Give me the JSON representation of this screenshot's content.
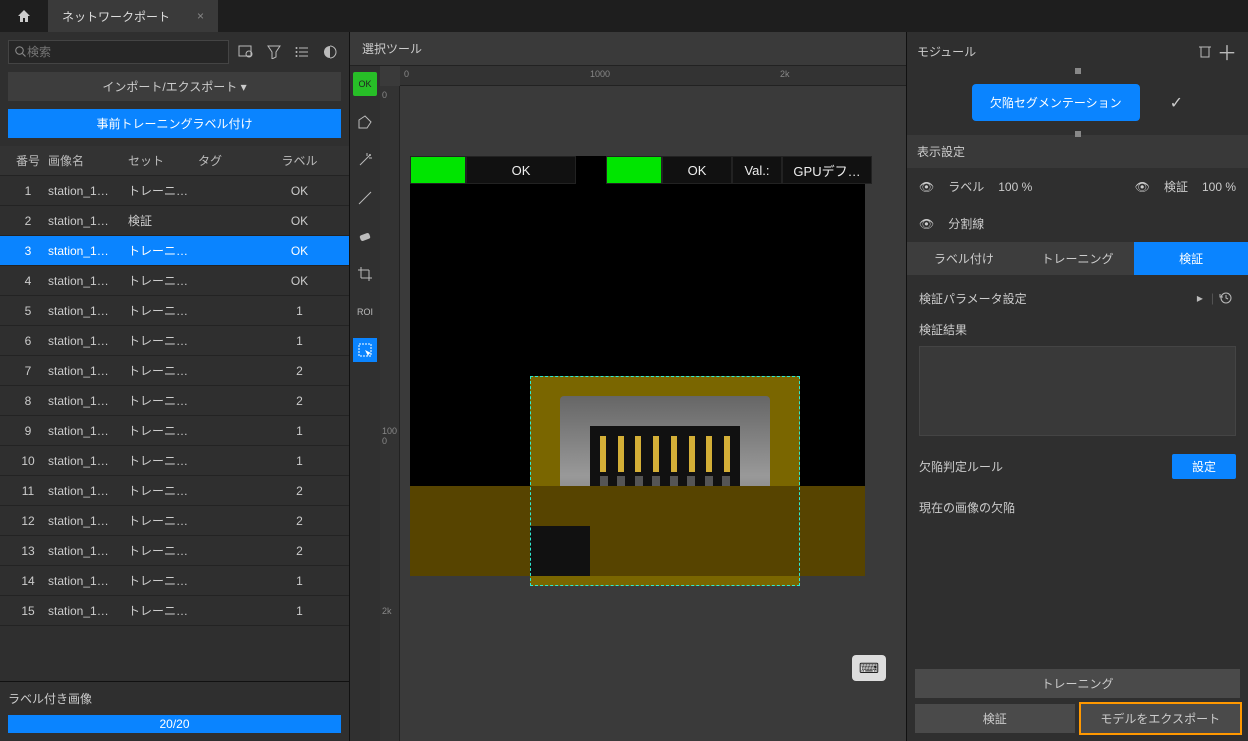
{
  "titlebar": {
    "tab_name": "ネットワークポート",
    "close": "×"
  },
  "left": {
    "search_placeholder": "検索",
    "import_export": "インポート/エクスポート ▾",
    "pretrain": "事前トレーニングラベル付け",
    "columns": {
      "idx": "番号",
      "name": "画像名",
      "set": "セット",
      "tag": "タグ",
      "label": "ラベル"
    },
    "rows": [
      {
        "idx": "1",
        "name": "station_1…",
        "set": "トレーニ…",
        "label": "OK"
      },
      {
        "idx": "2",
        "name": "station_1…",
        "set": "検証",
        "label": "OK"
      },
      {
        "idx": "3",
        "name": "station_1…",
        "set": "トレーニ…",
        "label": "OK",
        "selected": true
      },
      {
        "idx": "4",
        "name": "station_1…",
        "set": "トレーニ…",
        "label": "OK"
      },
      {
        "idx": "5",
        "name": "station_1…",
        "set": "トレーニ…",
        "label": "1"
      },
      {
        "idx": "6",
        "name": "station_1…",
        "set": "トレーニ…",
        "label": "1"
      },
      {
        "idx": "7",
        "name": "station_1…",
        "set": "トレーニ…",
        "label": "2"
      },
      {
        "idx": "8",
        "name": "station_1…",
        "set": "トレーニ…",
        "label": "2"
      },
      {
        "idx": "9",
        "name": "station_1…",
        "set": "トレーニ…",
        "label": "1"
      },
      {
        "idx": "10",
        "name": "station_1…",
        "set": "トレーニ…",
        "label": "1"
      },
      {
        "idx": "11",
        "name": "station_1…",
        "set": "トレーニ…",
        "label": "2"
      },
      {
        "idx": "12",
        "name": "station_1…",
        "set": "トレーニ…",
        "label": "2"
      },
      {
        "idx": "13",
        "name": "station_1…",
        "set": "トレーニ…",
        "label": "2"
      },
      {
        "idx": "14",
        "name": "station_1…",
        "set": "トレーニ…",
        "label": "1"
      },
      {
        "idx": "15",
        "name": "station_1…",
        "set": "トレーニ…",
        "label": "1"
      }
    ],
    "labeled_title": "ラベル付き画像",
    "labeled_progress": "20/20"
  },
  "center": {
    "title": "選択ツール",
    "tool_ok": "OK",
    "tool_roi": "ROI",
    "ruler_h": {
      "v0": "0",
      "v1000": "1000",
      "v2k": "2k"
    },
    "ruler_v": {
      "v0": "0",
      "v1000": "1000",
      "v2k": "2k"
    },
    "overlay": {
      "ok1": "OK",
      "ok2": "OK",
      "val": "Val.:",
      "gpu": "GPUデフ…"
    }
  },
  "right": {
    "module": "モジュール",
    "chip": "欠陥セグメンテーション",
    "disp_title": "表示設定",
    "label_lbl": "ラベル",
    "label_pct": "100 %",
    "verify_lbl": "検証",
    "verify_pct": "100 %",
    "seg_line": "分割線",
    "tabs": {
      "a": "ラベル付け",
      "b": "トレーニング",
      "c": "検証"
    },
    "param": "検証パラメータ設定",
    "result": "検証結果",
    "rule": "欠陥判定ルール",
    "setting_btn": "設定",
    "current_defects": "現在の画像の欠陥",
    "train_btn": "トレーニング",
    "verify_btn": "検証",
    "export_btn": "モデルをエクスポート"
  }
}
